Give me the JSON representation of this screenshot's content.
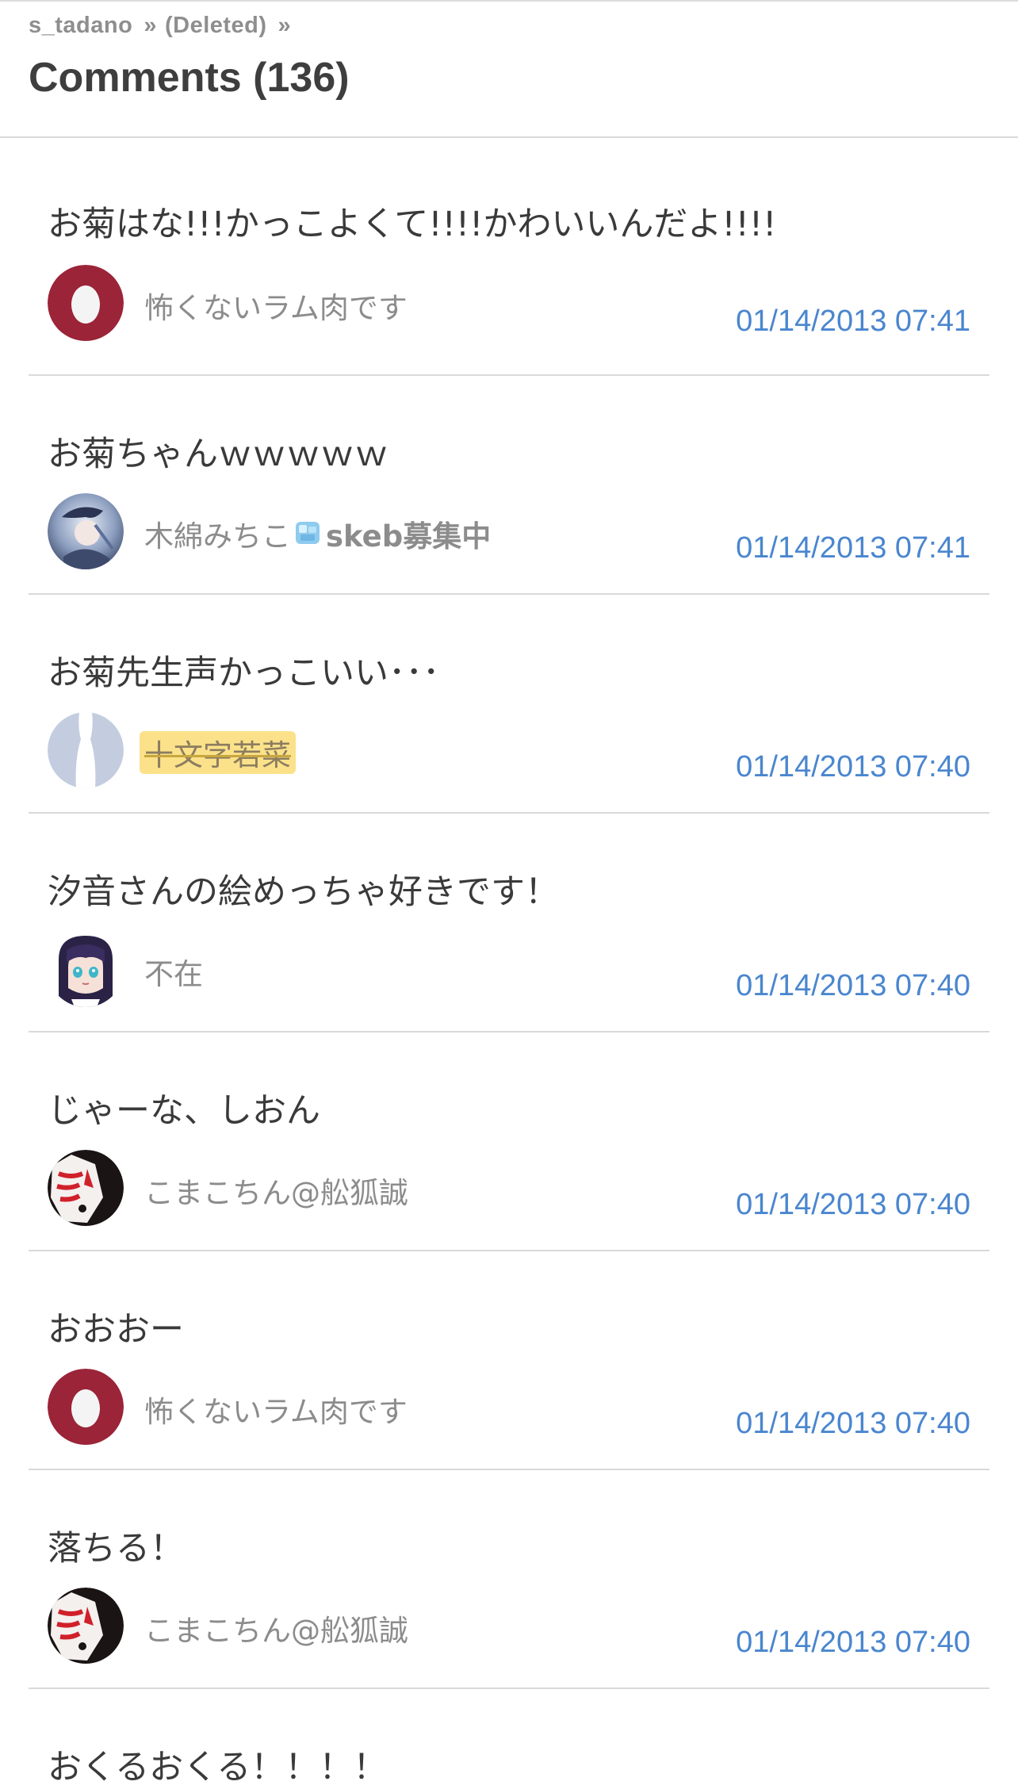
{
  "breadcrumb": {
    "user": "s_tadano",
    "separator": "»",
    "deleted": "(Deleted)"
  },
  "page_title": "Comments (136)",
  "comments": [
    {
      "text": "お菊はな!!!かっこよくて!!!!かわいいんだよ!!!!",
      "author": "怖くないラム肉です",
      "timestamp": "01/14/2013 07:41",
      "avatar": "egg-avatar-crimson"
    },
    {
      "text": "お菊ちゃんｗｗｗｗｗ",
      "author": "木綿みちこ",
      "author_suffix": "skeb募集中",
      "timestamp": "01/14/2013 07:41",
      "avatar": "illustrated-avatar-blue"
    },
    {
      "text": "お菊先生声かっこいい･･･",
      "author": "十文字若菜",
      "timestamp": "01/14/2013 07:40",
      "avatar": "default-silhouette-avatar"
    },
    {
      "text": "汐音さんの絵めっちゃ好きです！",
      "author": "不在",
      "timestamp": "01/14/2013 07:40",
      "avatar": "anime-girl-avatar"
    },
    {
      "text": "じゃーな、しおん",
      "author": "こまこちん@舩狐誠",
      "timestamp": "01/14/2013 07:40",
      "avatar": "fox-mask-avatar"
    },
    {
      "text": "おおおー",
      "author": "怖くないラム肉です",
      "timestamp": "01/14/2013 07:40",
      "avatar": "egg-avatar-crimson"
    },
    {
      "text": "落ちる！",
      "author": "こまこちん@舩狐誠",
      "timestamp": "01/14/2013 07:40",
      "avatar": "fox-mask-avatar"
    }
  ],
  "partial_comment": {
    "text": "おくるおくる！！！！"
  },
  "colors": {
    "timestamp": "#4a86cf",
    "author": "#8c8c8c",
    "highlight": "#fbe28a",
    "egg_avatar_bg": "#9b2438"
  }
}
